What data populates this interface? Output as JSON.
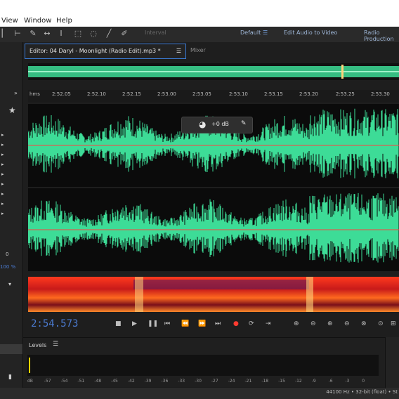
{
  "menubar": {
    "items": [
      "View",
      "Window",
      "Help"
    ]
  },
  "toolbar": {
    "workspace_items": [
      "Default",
      "Edit Audio to Video",
      "Radio Production"
    ],
    "left_label": "Interval"
  },
  "tabs": [
    {
      "label": "Editor: 04 Daryl - Moonlight (Radio Edit).mp3 *",
      "active": true
    },
    {
      "label": "Mixer",
      "active": false
    }
  ],
  "ruler": {
    "ticks": [
      "hms",
      "2:52.05",
      "2:52.10",
      "2:52.15",
      "2:53.00",
      "2:53.05",
      "2:53.10",
      "2:53.15",
      "2:53.20",
      "2:53.25",
      "2:53.30"
    ]
  },
  "hud": {
    "gain_label": "+0 dB"
  },
  "transport": {
    "timecode": "2:54.573"
  },
  "levels": {
    "title": "Levels",
    "scale": [
      "dB",
      "-57",
      "-54",
      "-51",
      "-48",
      "-45",
      "-42",
      "-39",
      "-36",
      "-33",
      "-30",
      "-27",
      "-24",
      "-21",
      "-18",
      "-15",
      "-12",
      "-9",
      "-6",
      "-3",
      "0"
    ]
  },
  "leftpanel": {
    "value_label": "0",
    "percent_label": "100 %"
  },
  "status": {
    "text": "44100 Hz • 32-bit (float) • St"
  },
  "colors": {
    "wave": "#3ddc97",
    "timecode": "#4b7bd1",
    "tab_active_border": "#3a7bd5"
  }
}
